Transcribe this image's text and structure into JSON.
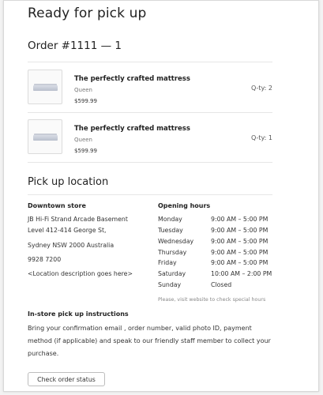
{
  "page": {
    "title": "Ready for pick up",
    "order_heading": "Order #1111 — 1"
  },
  "items": [
    {
      "name": "The perfectly crafted mattress",
      "variant": "Queen",
      "price": "$599.99",
      "qty": "Q-ty: 2",
      "image_icon": "mattress-image"
    },
    {
      "name": "The perfectly crafted mattress",
      "variant": "Queen",
      "price": "$599.99",
      "qty": "Q-ty: 1",
      "image_icon": "mattress-image"
    }
  ],
  "pickup": {
    "heading": "Pick up location",
    "store": {
      "title": "Downtown store",
      "address_line1": "JB Hi-Fi Strand Arcade Basement",
      "address_line2": "Level 412-414 George St,",
      "address_line3": "Sydney NSW 2000 Australia",
      "phone": "9928 7200",
      "description": "<Location description goes here>"
    },
    "hours": {
      "title": "Opening hours",
      "rows": [
        {
          "day": "Monday",
          "time": "9:00 AM – 5:00 PM"
        },
        {
          "day": "Tuesday",
          "time": "9:00 AM – 5:00 PM"
        },
        {
          "day": "Wednesday",
          "time": "9:00 AM – 5:00 PM"
        },
        {
          "day": "Thursday",
          "time": "9:00 AM – 5:00 PM"
        },
        {
          "day": "Friday",
          "time": "9:00 AM – 5:00 PM"
        },
        {
          "day": "Saturday",
          "time": "10:00 AM – 2:00 PM"
        },
        {
          "day": "Sunday",
          "time": "Closed"
        }
      ],
      "note": "Please, visit website to check special hours"
    }
  },
  "instructions": {
    "title": "In-store pick up instructions",
    "text": "Bring your confirmation email , order number, valid photo ID, payment method (if applicable) and speak to our friendly staff member to collect your purchase."
  },
  "actions": {
    "check_status_label": "Check order status"
  }
}
